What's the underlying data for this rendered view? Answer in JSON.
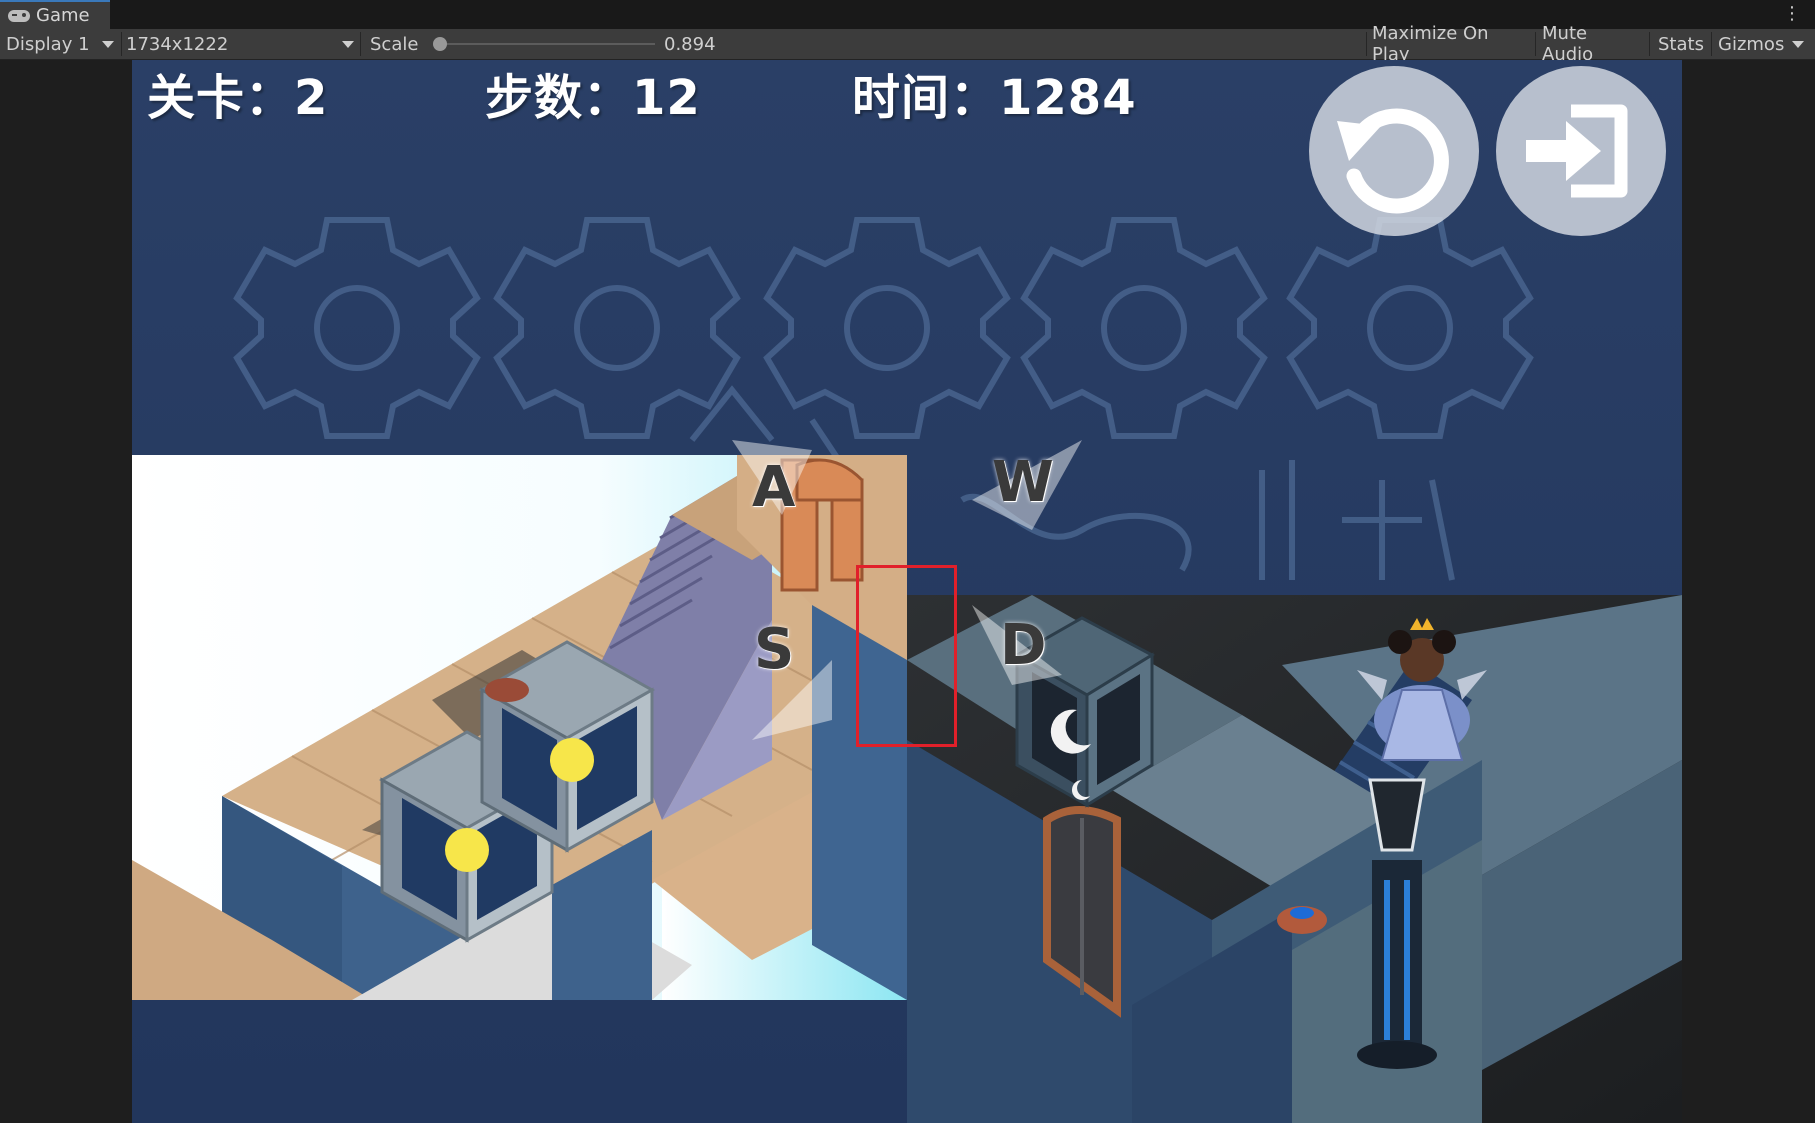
{
  "editor": {
    "tab_title": "Game",
    "display": "Display 1",
    "resolution": "1734x1222",
    "scale_label": "Scale",
    "scale_value": "0.894",
    "buttons": [
      "Maximize On Play",
      "Mute Audio",
      "Stats",
      "Gizmos"
    ]
  },
  "hud": {
    "level_text": "关卡：2",
    "steps_text": "步数：12",
    "time_text": "时间：1284"
  },
  "controls": {
    "keys": [
      "A",
      "W",
      "S",
      "D"
    ],
    "restart_icon": "restart-icon",
    "exit_icon": "exit-icon"
  },
  "colors": {
    "sky": "#23375d",
    "highlight": "#e1202a",
    "sand": "#d6b48c",
    "stone": "#3d5f86"
  }
}
